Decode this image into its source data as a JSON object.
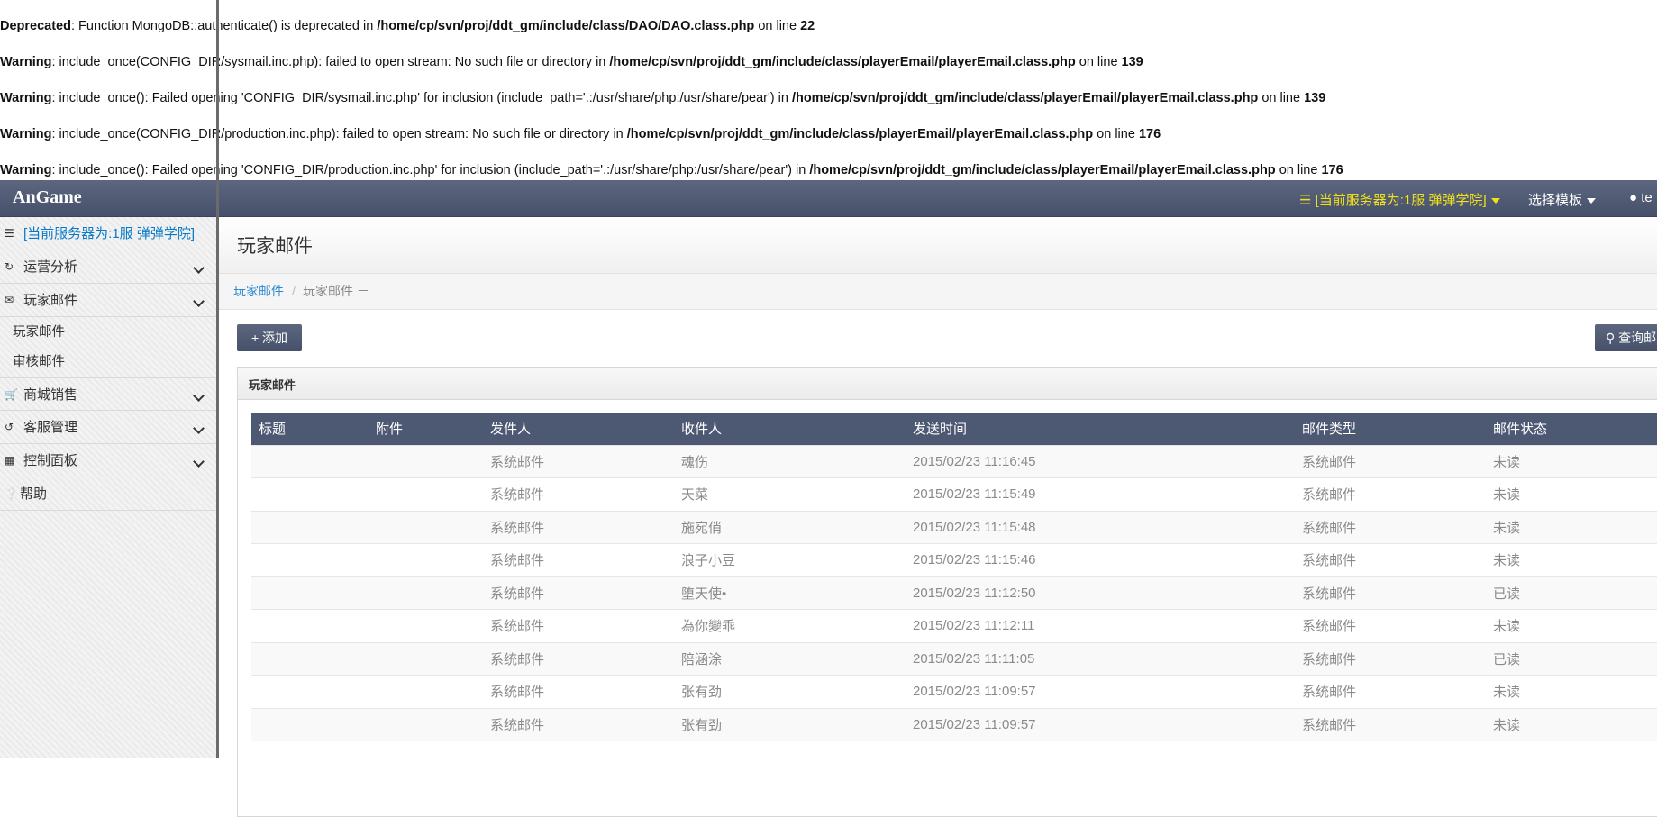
{
  "errors": [
    {
      "type": "Deprecated",
      "message": ": Function MongoDB::authenticate() is deprecated in ",
      "file": "/home/cp/svn/proj/ddt_gm/include/class/DAO/DAO.class.php",
      "on_line": " on line ",
      "line": "22"
    },
    {
      "type": "Warning",
      "message": ": include_once(CONFIG_DIR/sysmail.inc.php): failed to open stream: No such file or directory in ",
      "file": "/home/cp/svn/proj/ddt_gm/include/class/playerEmail/playerEmail.class.php",
      "on_line": " on line ",
      "line": "139"
    },
    {
      "type": "Warning",
      "message": ": include_once(): Failed opening 'CONFIG_DIR/sysmail.inc.php' for inclusion (include_path='.:/usr/share/php:/usr/share/pear') in ",
      "file": "/home/cp/svn/proj/ddt_gm/include/class/playerEmail/playerEmail.class.php",
      "on_line": " on line ",
      "line": "139"
    },
    {
      "type": "Warning",
      "message": ": include_once(CONFIG_DIR/production.inc.php): failed to open stream: No such file or directory in ",
      "file": "/home/cp/svn/proj/ddt_gm/include/class/playerEmail/playerEmail.class.php",
      "on_line": " on line ",
      "line": "176"
    },
    {
      "type": "Warning",
      "message": ": include_once(): Failed opening 'CONFIG_DIR/production.inc.php' for inclusion (include_path='.:/usr/share/php:/usr/share/pear') in ",
      "file": "/home/cp/svn/proj/ddt_gm/include/class/playerEmail/playerEmail.class.php",
      "on_line": " on line ",
      "line": "176"
    }
  ],
  "navbar": {
    "brand": "AnGame",
    "server_label": "[当前服务器为:1服 弹弹学院]",
    "template_label": "选择模板",
    "user_label": "te",
    "server_color": "#f1e11c"
  },
  "sidebar": {
    "server_label": "[当前服务器为:1服 弹弹学院]",
    "items": [
      {
        "label": "运营分析",
        "icon": "refresh-icon"
      },
      {
        "label": "玩家邮件",
        "icon": "envelope-icon"
      },
      {
        "label": "商城销售",
        "icon": "cart-icon"
      },
      {
        "label": "客服管理",
        "icon": "circle-arrow-icon"
      },
      {
        "label": "控制面板",
        "icon": "grid-icon"
      },
      {
        "label": "帮助",
        "icon": "question-icon"
      }
    ],
    "sub_items": [
      "玩家邮件",
      "审核邮件"
    ]
  },
  "page": {
    "title": "玩家邮件",
    "breadcrumb_link": "玩家邮件",
    "breadcrumb_sep": "/",
    "breadcrumb_current": "玩家邮件 －",
    "add_button": "添加",
    "query_button": "查询邮",
    "box_title": "玩家邮件"
  },
  "table": {
    "headers": [
      "标题",
      "附件",
      "发件人",
      "收件人",
      "发送时间",
      "邮件类型",
      "邮件状态"
    ],
    "rows": [
      [
        "",
        "",
        "系统邮件",
        "魂伤",
        "2015/02/23 11:16:45",
        "系统邮件",
        "未读"
      ],
      [
        "",
        "",
        "系统邮件",
        "天菜",
        "2015/02/23 11:15:49",
        "系统邮件",
        "未读"
      ],
      [
        "",
        "",
        "系统邮件",
        "施宛俏",
        "2015/02/23 11:15:48",
        "系统邮件",
        "未读"
      ],
      [
        "",
        "",
        "系统邮件",
        "浪子小豆",
        "2015/02/23 11:15:46",
        "系统邮件",
        "未读"
      ],
      [
        "",
        "",
        "系统邮件",
        "堕天使•",
        "2015/02/23 11:12:50",
        "系统邮件",
        "已读"
      ],
      [
        "",
        "",
        "系统邮件",
        "為你變乖",
        "2015/02/23 11:12:11",
        "系统邮件",
        "未读"
      ],
      [
        "",
        "",
        "系统邮件",
        "陪涵涂",
        "2015/02/23 11:11:05",
        "系统邮件",
        "已读"
      ],
      [
        "",
        "",
        "系统邮件",
        "张有劲",
        "2015/02/23 11:09:57",
        "系统邮件",
        "未读"
      ],
      [
        "",
        "",
        "系统邮件",
        "张有劲",
        "2015/02/23 11:09:57",
        "系统邮件",
        "未读"
      ]
    ]
  }
}
